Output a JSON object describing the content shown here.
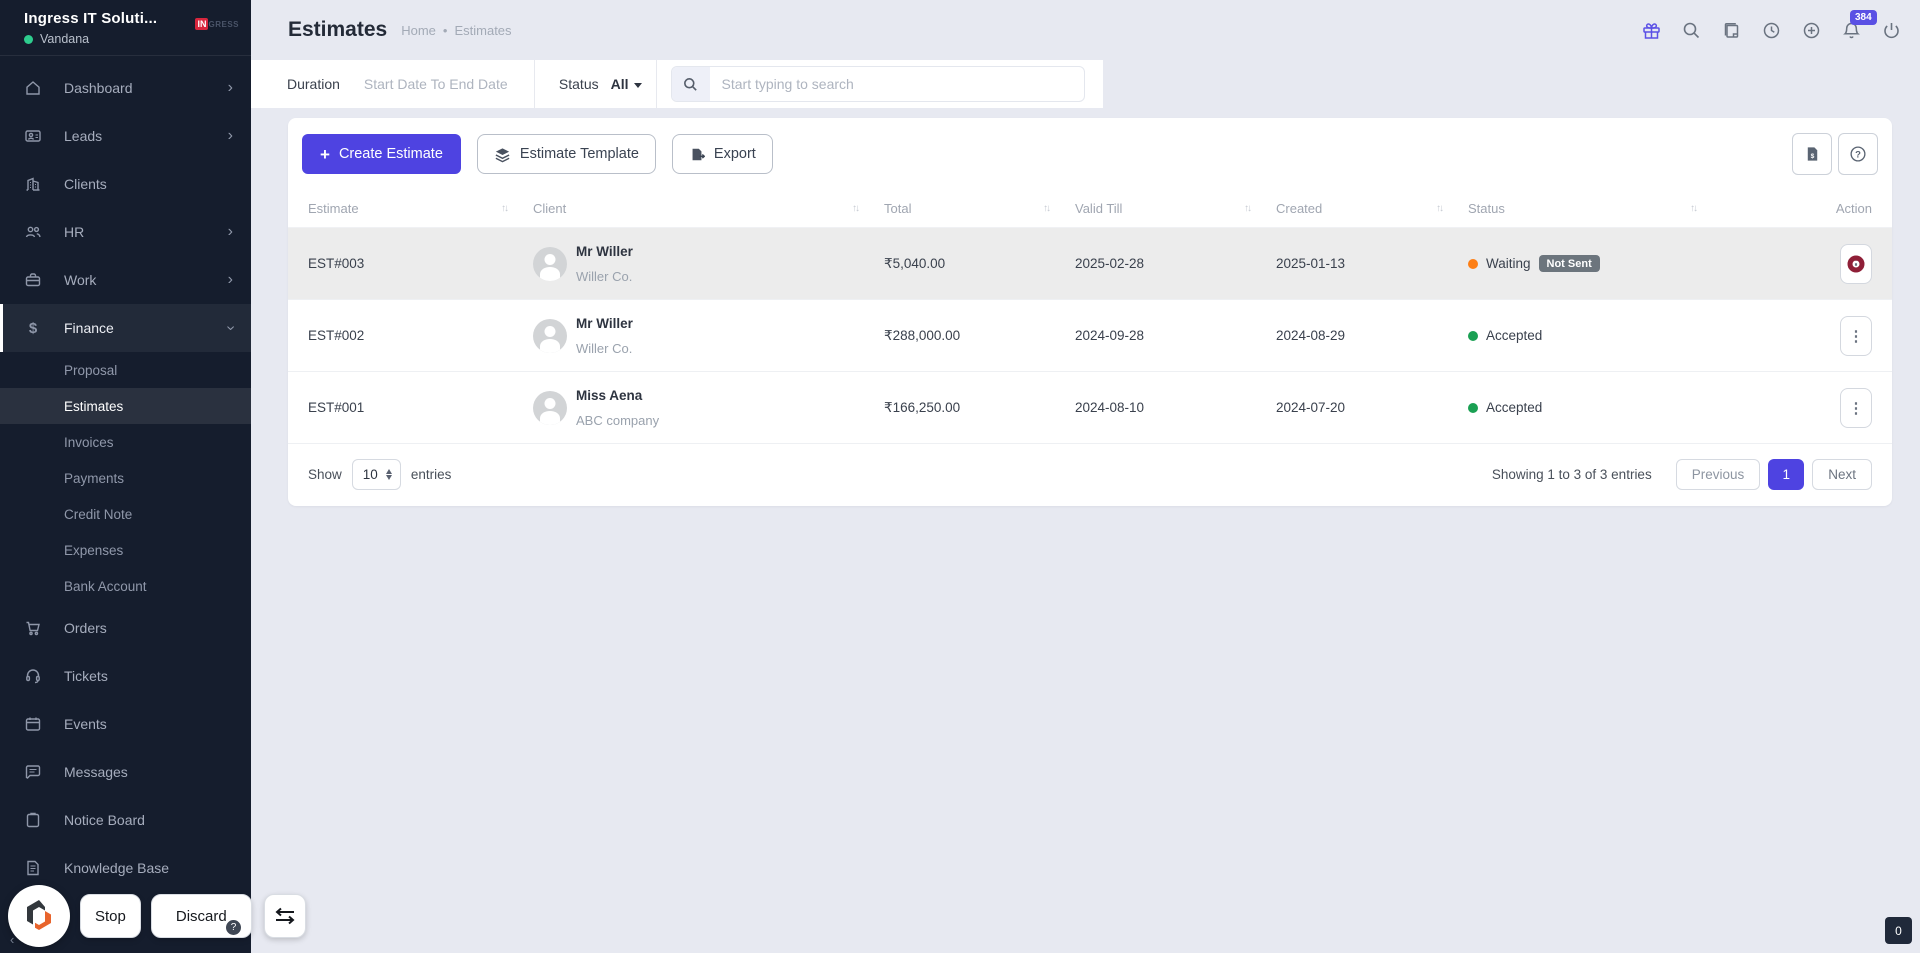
{
  "sidebar": {
    "company": "Ingress IT Soluti...",
    "user": "Vandana",
    "logo_primary": "IN",
    "logo_secondary": "GRESS",
    "items": [
      {
        "label": "Dashboard",
        "icon": "home"
      },
      {
        "label": "Leads",
        "icon": "id-card"
      },
      {
        "label": "Clients",
        "icon": "building"
      },
      {
        "label": "HR",
        "icon": "users"
      },
      {
        "label": "Work",
        "icon": "briefcase"
      },
      {
        "label": "Finance",
        "icon": "dollar"
      },
      {
        "label": "Orders",
        "icon": "cart"
      },
      {
        "label": "Tickets",
        "icon": "headset"
      },
      {
        "label": "Events",
        "icon": "calendar"
      },
      {
        "label": "Messages",
        "icon": "chat"
      },
      {
        "label": "Notice Board",
        "icon": "clipboard"
      },
      {
        "label": "Knowledge Base",
        "icon": "document"
      }
    ],
    "finance_sub": [
      {
        "label": "Proposal"
      },
      {
        "label": "Estimates",
        "active": true
      },
      {
        "label": "Invoices"
      },
      {
        "label": "Payments"
      },
      {
        "label": "Credit Note"
      },
      {
        "label": "Expenses"
      },
      {
        "label": "Bank Account"
      }
    ]
  },
  "header": {
    "title": "Estimates",
    "breadcrumb_home": "Home",
    "breadcrumb_current": "Estimates",
    "notification_count": "384"
  },
  "filters": {
    "duration_label": "Duration",
    "duration_placeholder": "Start Date To End Date",
    "status_label": "Status",
    "status_value": "All",
    "search_placeholder": "Start typing to search"
  },
  "toolbar": {
    "create_label": "Create Estimate",
    "template_label": "Estimate Template",
    "export_label": "Export"
  },
  "table": {
    "columns": [
      "Estimate",
      "Client",
      "Total",
      "Valid Till",
      "Created",
      "Status",
      "Action"
    ],
    "rows": [
      {
        "estimate": "EST#003",
        "client_name": "Mr Willer",
        "client_company": "Willer Co.",
        "total": "₹5,040.00",
        "valid_till": "2025-02-28",
        "created": "2025-01-13",
        "status": "Waiting",
        "status_color": "#fd7e14",
        "status_badge": "Not Sent"
      },
      {
        "estimate": "EST#002",
        "client_name": "Mr Willer",
        "client_company": "Willer Co.",
        "total": "₹288,000.00",
        "valid_till": "2024-09-28",
        "created": "2024-08-29",
        "status": "Accepted",
        "status_color": "#1aa053"
      },
      {
        "estimate": "EST#001",
        "client_name": "Miss Aena",
        "client_company": "ABC company",
        "total": "₹166,250.00",
        "valid_till": "2024-08-10",
        "created": "2024-07-20",
        "status": "Accepted",
        "status_color": "#1aa053"
      }
    ]
  },
  "pagination": {
    "show_label": "Show",
    "page_size": "10",
    "entries_label": "entries",
    "summary": "Showing 1 to 3 of 3 entries",
    "previous_label": "Previous",
    "current_page": "1",
    "next_label": "Next"
  },
  "recorder": {
    "stop_label": "Stop",
    "discard_label": "Discard",
    "corner_counter": "0"
  },
  "icons": {
    "plus": "+",
    "chevron_right": "›",
    "chevron_left": "‹",
    "sort_up": "↑",
    "sort_down": "↓",
    "dots_vertical": "⋮",
    "finance_dollar": "$",
    "breadcrumb_sep": "•",
    "question": "?"
  },
  "colors": {
    "primary": "#4e43e1",
    "sidebar_bg": "#151d2d",
    "page_bg": "#e7e9f1",
    "waiting_orange": "#fd7e14",
    "accepted_green": "#1aa053",
    "badge_gray": "#6c757d",
    "click_ring_red": "#8f1f37"
  }
}
